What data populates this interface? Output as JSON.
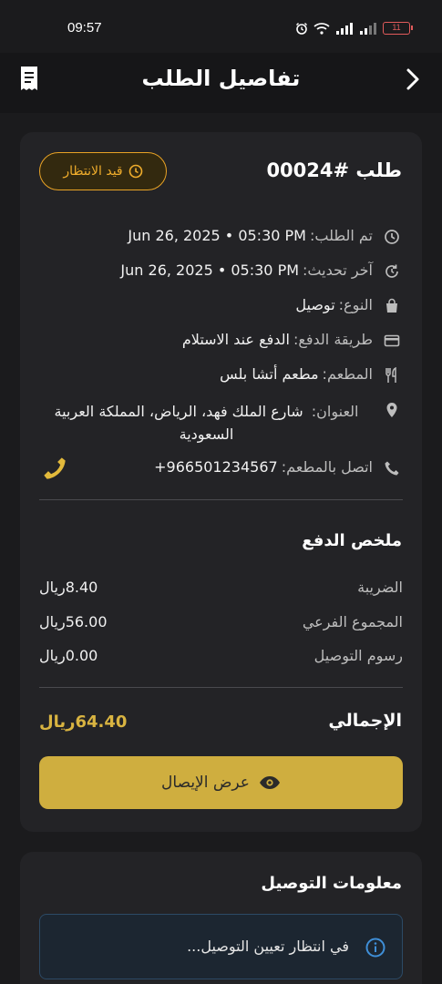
{
  "status_bar": {
    "time": "09:57",
    "battery": "11"
  },
  "header": {
    "title": "تفاصيل الطلب"
  },
  "order": {
    "title": "طلب #00024",
    "status": "قيد الانتظار",
    "rows": [
      {
        "label": "تم الطلب:",
        "value": "Jun 26, 2025 • 05:30 PM",
        "icon": "clock-icon"
      },
      {
        "label": "آخر تحديث:",
        "value": "Jun 26, 2025 • 05:30 PM",
        "icon": "refresh-icon"
      },
      {
        "label": "النوع:",
        "value": "توصيل",
        "icon": "bag-icon"
      },
      {
        "label": "طريقة الدفع:",
        "value": "الدفع عند الاستلام",
        "icon": "card-icon"
      },
      {
        "label": "المطعم:",
        "value": "مطعم أتشا بلس",
        "icon": "restaurant-icon"
      },
      {
        "label": "العنوان:",
        "value": "شارع الملك فهد، الرياض، المملكة العربية السعودية",
        "icon": "location-icon"
      },
      {
        "label": "اتصل بالمطعم:",
        "value": "+966501234567",
        "icon": "phone-icon"
      }
    ]
  },
  "payment_summary": {
    "title": "ملخص الدفع",
    "rows": [
      {
        "label": "الضريبة",
        "value": "8.40ريال"
      },
      {
        "label": "المجموع الفرعي",
        "value": "56.00ريال"
      },
      {
        "label": "رسوم التوصيل",
        "value": "0.00ريال"
      }
    ],
    "total_label": "الإجمالي",
    "total_value": "64.40ريال",
    "receipt_button": "عرض الإيصال"
  },
  "delivery": {
    "title": "معلومات التوصيل",
    "notice": "في انتظار تعيين التوصيل..."
  },
  "colors": {
    "accent": "#cfae3f",
    "pending": "#e9a325",
    "background": "#1b1b1d",
    "card": "#232326"
  }
}
